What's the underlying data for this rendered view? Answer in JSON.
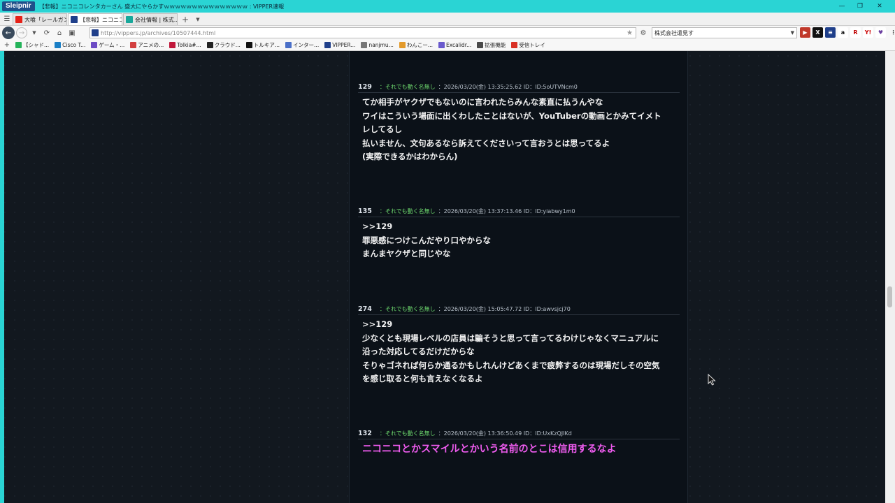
{
  "window": {
    "brand": "Sleipnir",
    "title": "【悲報】ニコニコレンタカーさん 盛大にやらかすｗｗｗｗｗｗｗｗｗｗｗｗｗｗｗ : VIPPER速報"
  },
  "tabs": [
    {
      "label": "大喰「レールガン」...",
      "icon_color": "#e62117"
    },
    {
      "label": "【悲報】ニコニコレ...",
      "icon_color": "#1f3f8a",
      "active": true
    },
    {
      "label": "会社情報 | 株式...",
      "icon_color": "#18a89b"
    }
  ],
  "nav": {
    "url": "http://vippers.jp/archives/10507444.html",
    "search": "株式会社遣見す"
  },
  "bookmarks": [
    {
      "label": "【シャド...",
      "color": "#25b35a"
    },
    {
      "label": "Cisco T...",
      "color": "#1b7fc6"
    },
    {
      "label": "ゲーム・...",
      "color": "#6d4cc5"
    },
    {
      "label": "アニメの...",
      "color": "#d23f3f"
    },
    {
      "label": "Tolkia#...",
      "color": "#c0183b"
    },
    {
      "label": "クラウド...",
      "color": "#222222"
    },
    {
      "label": "トルキア...",
      "color": "#111111"
    },
    {
      "label": "インター...",
      "color": "#4b70c8"
    },
    {
      "label": "VIPPER...",
      "color": "#1f3f8a"
    },
    {
      "label": "nanjmu...",
      "color": "#777777"
    },
    {
      "label": "わんこー...",
      "color": "#e39a2b"
    },
    {
      "label": "Excalidr...",
      "color": "#6a5acd"
    },
    {
      "label": "拡張機能",
      "color": "#4a4a4a"
    },
    {
      "label": "受信トレイ",
      "color": "#d93025"
    }
  ],
  "posts": [
    {
      "num": "129",
      "name": "：それでも動く名無し",
      "meta": "：2026/03/20(金) 13:35:25.62 ID：ID:5oUTVNcm0",
      "lines": [
        "てか相手がヤクザでもないのに言われたらみんな素直に払うんやな",
        "ワイはこういう場面に出くわしたことはないが、YouTuberの動画とかみてイメト",
        "レしてるし",
        "払いません、文句あるなら訴えてくださいって言おうとは思ってるよ",
        "(実際できるかはわからん)"
      ]
    },
    {
      "num": "135",
      "name": "：それでも動く名無し",
      "meta": "：2026/03/20(金) 13:37:13.46 ID：ID:yiabwy1m0",
      "lines": [
        ">>129",
        "罪悪感につけこんだやり口やからな",
        "まんまヤクザと同じやな"
      ]
    },
    {
      "num": "274",
      "name": "：それでも動く名無し",
      "meta": "：2026/03/20(金) 15:05:47.72 ID：ID:awvsjcj70",
      "lines": [
        ">>129",
        "少なくとも現場レベルの店員は騙そうと思って言ってるわけじゃなくマニュアルに",
        "沿った対応してるだけだからな",
        "そりゃゴネれば何らか通るかもしれんけどあくまで疲弊するのは現場だしその空気",
        "を感じ取ると何も言えなくなるよ"
      ]
    },
    {
      "num": "132",
      "name": "：それでも動く名無し",
      "meta": "：2026/03/20(金) 13:36:50.49 ID：ID:UxKzQJIKd",
      "lines": [
        "ニコニコとかスマイルとかいう名前のとこは信用するなよ"
      ]
    }
  ]
}
